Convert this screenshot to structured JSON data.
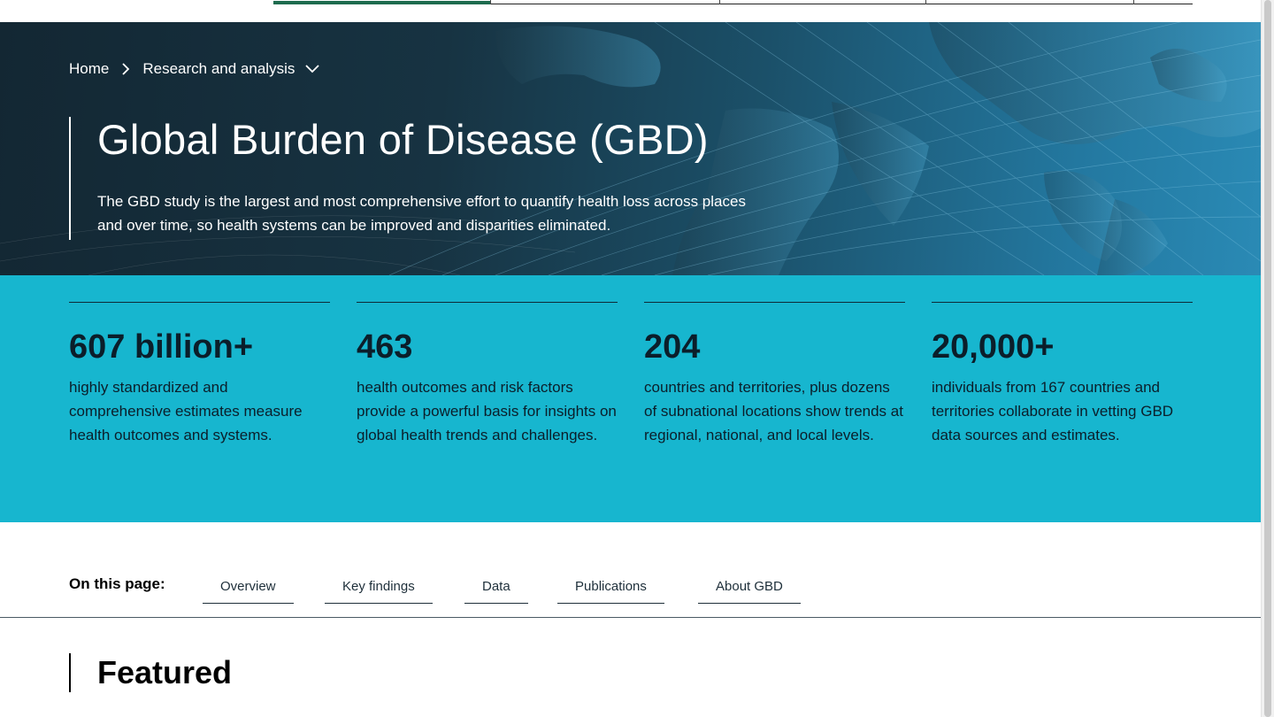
{
  "breadcrumb": {
    "home": "Home",
    "current": "Research and analysis"
  },
  "hero": {
    "title": "Global Burden of Disease (GBD)",
    "description": "The GBD study is the largest and most comprehensive effort to quantify health loss across places and over time, so health systems can be improved and disparities eliminated."
  },
  "stats": [
    {
      "value": "607 billion+",
      "text": "highly standardized and comprehensive estimates measure health outcomes and systems."
    },
    {
      "value": "463",
      "text": "health outcomes and risk factors provide a powerful basis for insights on global health trends and challenges."
    },
    {
      "value": "204",
      "text": "countries and territories, plus dozens of subnational locations show trends at regional, national, and local levels."
    },
    {
      "value": "20,000+",
      "text": "individuals from 167 countries and territories collaborate in vetting GBD data sources and estimates."
    }
  ],
  "onpage": {
    "label": "On this page:",
    "links": [
      "Overview",
      "Key findings",
      "Data",
      "Publications",
      "About GBD"
    ]
  },
  "featured": {
    "title": "Featured"
  },
  "colors": {
    "hero_dark": "#132733",
    "hero_light": "#2a8ab5",
    "stats_band": "#17b6cf",
    "nav_active": "#1d6b4e"
  }
}
